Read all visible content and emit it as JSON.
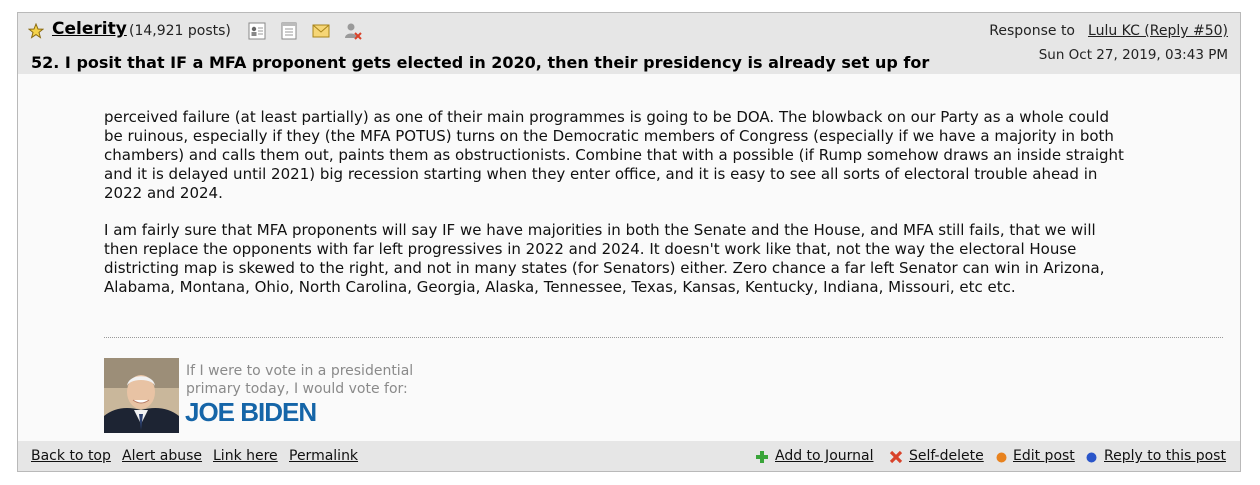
{
  "header": {
    "author": "Celerity",
    "post_count": "(14,921 posts)",
    "icons": [
      "star-icon",
      "profile-icon",
      "journal-icon",
      "email-icon",
      "ignore-user-icon"
    ],
    "response_label": "Response to",
    "response_link": "Lulu KC (Reply #50)",
    "date": "Sun Oct 27, 2019, 03:43 PM",
    "title": "52. I posit that IF a MFA proponent gets elected in 2020, then their presidency is already set up for"
  },
  "body": {
    "paragraphs": [
      "perceived failure (at least partially) as one of their main programmes is going to be DOA. The blowback on our Party as a whole could be ruinous, especially if they (the MFA POTUS) turns on the Democratic members of Congress (especially if we have a majority in both chambers) and calls them out, paints them as obstructionists. Combine that with a possible (if Rump somehow draws an inside straight and it is delayed until 2021) big recession starting when they enter office, and it is easy to see all sorts of electoral trouble ahead in 2022 and 2024.",
      "I am fairly sure that MFA proponents will say IF we have majorities in both the Senate and the House, and MFA still fails, that we will then replace the opponents with far left progressives in 2022 and 2024. It doesn't work like that, not the way the electoral House districting map is skewed to the right, and not in many states (for Senators) either. Zero chance a far left Senator can win in Arizona, Alabama, Montana, Ohio, North Carolina, Georgia, Alaska, Tennessee, Texas, Kansas, Kentucky, Indiana, Missouri, etc etc."
    ]
  },
  "signature": {
    "line1": "If I were to vote in a presidential",
    "line2": "primary today, I would vote for:",
    "candidate": "JOE BIDEN"
  },
  "footer": {
    "left_links": [
      "Back to top",
      "Alert abuse",
      "Link here",
      "Permalink"
    ],
    "add_journal": "Add to Journal",
    "self_delete": "Self-delete",
    "edit_post": "Edit post",
    "reply": "Reply to this post"
  },
  "colors": {
    "header_bg": "#e6e6e6",
    "body_bg": "#fafafa",
    "candidate_blue": "#1565a8",
    "edit_dot": "#e8821e",
    "reply_dot": "#2a55c9",
    "add_green": "#3aa53a",
    "delete_red": "#d9422a"
  }
}
